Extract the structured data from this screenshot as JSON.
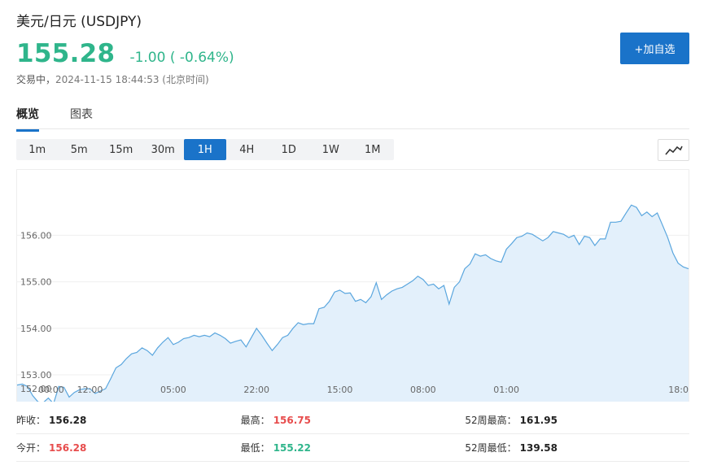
{
  "header": {
    "title": "美元/日元  (USDJPY)",
    "price": "155.28",
    "change": "-1.00 ( -0.64%)",
    "status_label": "交易中，",
    "timestamp": "2024-11-15 18:44:53 (北京时间)",
    "add_label": "+加自选",
    "accent_color": "#1a73c9",
    "down_color": "#2fb58b",
    "up_color": "#e74c4c"
  },
  "tabs": [
    {
      "label": "概览",
      "active": true
    },
    {
      "label": "图表",
      "active": false
    }
  ],
  "periods": [
    {
      "label": "1m",
      "active": false
    },
    {
      "label": "5m",
      "active": false
    },
    {
      "label": "15m",
      "active": false
    },
    {
      "label": "30m",
      "active": false
    },
    {
      "label": "1H",
      "active": true
    },
    {
      "label": "4H",
      "active": false
    },
    {
      "label": "1D",
      "active": false
    },
    {
      "label": "1W",
      "active": false
    },
    {
      "label": "1M",
      "active": false
    }
  ],
  "chart_type_icon": "line-chart-icon",
  "chart_data": {
    "type": "area",
    "ylim": [
      152.65,
      157.3
    ],
    "yticks": [
      "153.00",
      "154.00",
      "155.00",
      "156.00"
    ],
    "ytick_values": [
      153.0,
      154.0,
      155.0,
      156.0
    ],
    "xtick_labels": [
      "12:00",
      "05:00",
      "22:00",
      "15:00",
      "08:00",
      "01:00",
      "18:0"
    ],
    "xtick_positions": [
      14,
      30,
      46,
      62,
      78,
      94,
      110
    ],
    "first_xtick": "00:00",
    "first_ytick": "152.00",
    "values": [
      152.78,
      152.8,
      152.75,
      152.55,
      152.42,
      152.4,
      152.5,
      152.38,
      152.75,
      152.73,
      152.52,
      152.62,
      152.68,
      152.7,
      152.7,
      152.6,
      152.65,
      152.7,
      152.92,
      153.15,
      153.22,
      153.35,
      153.45,
      153.48,
      153.58,
      153.52,
      153.42,
      153.58,
      153.7,
      153.8,
      153.65,
      153.7,
      153.78,
      153.8,
      153.85,
      153.82,
      153.85,
      153.82,
      153.9,
      153.85,
      153.78,
      153.68,
      153.72,
      153.75,
      153.6,
      153.8,
      154.0,
      153.85,
      153.68,
      153.52,
      153.65,
      153.8,
      153.85,
      154.0,
      154.12,
      154.08,
      154.1,
      154.1,
      154.42,
      154.45,
      154.58,
      154.78,
      154.82,
      154.75,
      154.76,
      154.58,
      154.62,
      154.55,
      154.68,
      154.98,
      154.62,
      154.72,
      154.8,
      154.85,
      154.88,
      154.95,
      155.02,
      155.12,
      155.05,
      154.92,
      154.95,
      154.85,
      154.92,
      154.52,
      154.88,
      155.0,
      155.28,
      155.38,
      155.6,
      155.55,
      155.58,
      155.5,
      155.45,
      155.42,
      155.7,
      155.82,
      155.95,
      155.98,
      156.05,
      156.02,
      155.95,
      155.88,
      155.95,
      156.08,
      156.05,
      156.02,
      155.95,
      156.0,
      155.8,
      155.98,
      155.95,
      155.78,
      155.92,
      155.92,
      156.28,
      156.28,
      156.3,
      156.48,
      156.65,
      156.6,
      156.42,
      156.5,
      156.4,
      156.48,
      156.22,
      155.95,
      155.62,
      155.4,
      155.32,
      155.28
    ]
  },
  "stats": [
    [
      {
        "label": "昨收：",
        "value": "156.28",
        "tone": "plain"
      },
      {
        "label": "最高：",
        "value": "156.75",
        "tone": "up"
      },
      {
        "label": "52周最高：",
        "value": "161.95",
        "tone": "plain"
      }
    ],
    [
      {
        "label": "今开：",
        "value": "156.28",
        "tone": "up"
      },
      {
        "label": "最低：",
        "value": "155.22",
        "tone": "down"
      },
      {
        "label": "52周最低：",
        "value": "139.58",
        "tone": "plain"
      }
    ]
  ]
}
